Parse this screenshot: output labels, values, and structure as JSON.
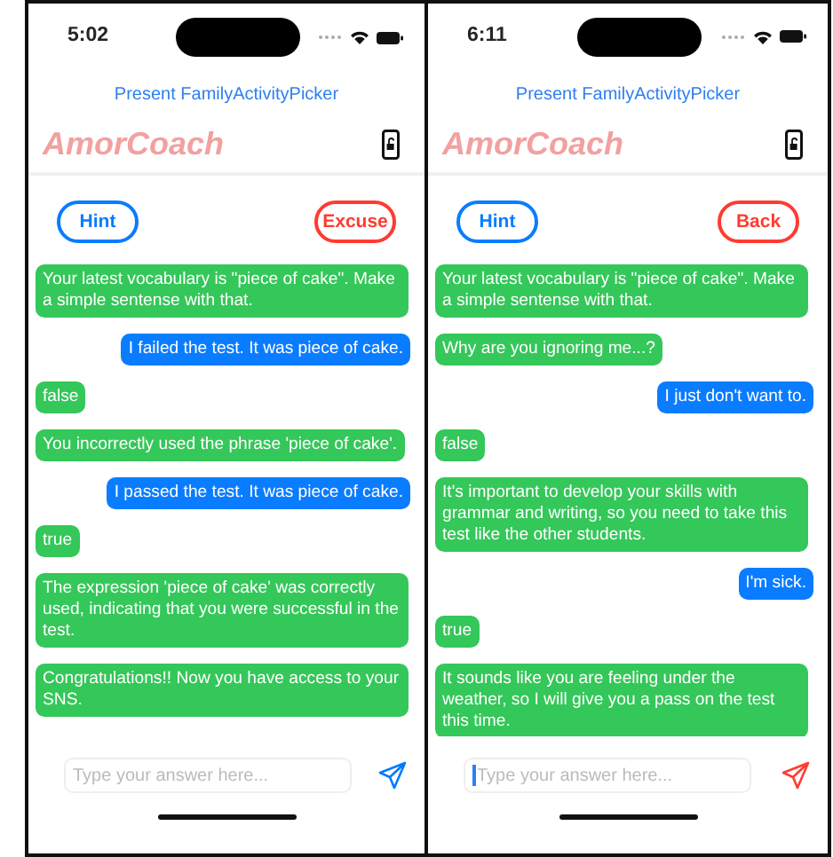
{
  "phones": [
    {
      "time": "5:02",
      "top_link": "Present FamilyActivityPicker",
      "app_title": "AmorCoach",
      "hint_button": "Hint",
      "action_button": "Excuse",
      "messages": [
        {
          "kind": "coach",
          "text": "Your latest vocabulary is \"piece of cake\". Make a simple sentense with that."
        },
        {
          "kind": "user",
          "text": "I failed the test. It was piece of cake."
        },
        {
          "kind": "coach",
          "text": "false"
        },
        {
          "kind": "coach",
          "text": "You incorrectly used the phrase 'piece of cake'."
        },
        {
          "kind": "user",
          "text": "I passed the test. It was piece of cake."
        },
        {
          "kind": "coach",
          "text": "true"
        },
        {
          "kind": "coach",
          "text": "The expression 'piece of cake' was correctly used, indicating that you were successful in the test."
        },
        {
          "kind": "coach",
          "text": "Congratulations!! Now you have access to your SNS."
        }
      ],
      "input": {
        "placeholder": "Type your answer here...",
        "focused": false
      },
      "send_icon": {
        "color": "#007aff"
      }
    },
    {
      "time": "6:11",
      "top_link": "Present FamilyActivityPicker",
      "app_title": "AmorCoach",
      "hint_button": "Hint",
      "action_button": "Back",
      "messages": [
        {
          "kind": "coach",
          "text": "Your latest vocabulary is \"piece of cake\". Make a simple sentense with that."
        },
        {
          "kind": "coach",
          "text": "Why are you ignoring me...?"
        },
        {
          "kind": "user",
          "text": "I just don't want to."
        },
        {
          "kind": "coach",
          "text": "false"
        },
        {
          "kind": "coach",
          "text": "It's important to develop your skills with grammar and writing, so you need to take this test like the other students."
        },
        {
          "kind": "user",
          "text": "I'm sick."
        },
        {
          "kind": "coach",
          "text": "true"
        },
        {
          "kind": "coach",
          "text": "It sounds like you are feeling under the weather, so I will give you a pass on the test this time."
        }
      ],
      "input": {
        "placeholder": "Type your answer here...",
        "focused": true
      },
      "send_icon": {
        "color": "#ff3b30"
      }
    }
  ]
}
